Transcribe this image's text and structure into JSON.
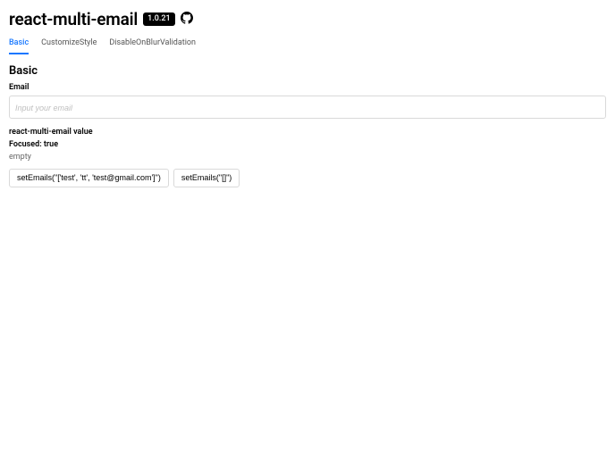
{
  "header": {
    "title": "react-multi-email",
    "version": "1.0.21"
  },
  "tabs": [
    {
      "label": "Basic",
      "active": true
    },
    {
      "label": "CustomizeStyle",
      "active": false
    },
    {
      "label": "DisableOnBlurValidation",
      "active": false
    }
  ],
  "section": {
    "title": "Basic",
    "field_label": "Email",
    "placeholder": "Input your email",
    "value_heading": "react-multi-email value",
    "focused_label": "Focused: ",
    "focused_value": "true",
    "current_value": "empty"
  },
  "buttons": {
    "set_sample": "setEmails(\"['test', 'tt', 'test@gmail.com']\")",
    "set_empty": "setEmails(\"[]\")"
  }
}
